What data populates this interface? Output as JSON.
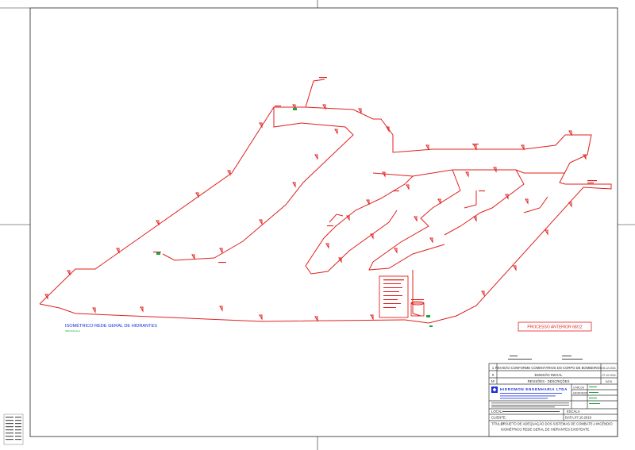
{
  "drawing": {
    "caption": "ISOMÉTRICO REDE GERAL DE HIDRANTES",
    "caption_sub": "SEM ESCALA",
    "process_box": "PROCESSO ANTERIOR 68/12",
    "colors": {
      "pipe": "#e0201e",
      "caption": "#1a2fd6",
      "marker": "#1aa83a",
      "process_box": "#e0201e",
      "logo": "#1a2fd6"
    }
  },
  "title_block": {
    "revisions": [
      {
        "no": "1",
        "description": "REVISÃO CONFORME COMENTÁRIOS DO CORPO DE BOMBEIROS",
        "date": "05.12.2016"
      },
      {
        "no": "0",
        "description": "EMISSÃO INICIAL",
        "date": "07.10.2016"
      }
    ],
    "rev_header": {
      "no": "Nº",
      "description": "REVISÕES - DESCRIÇÕES",
      "date": "DATA"
    },
    "company": "HIDROMON ENGENHARIA LTDA",
    "signers": [
      "CARLOS",
      "HIDROMON"
    ],
    "escala_label": "ESCALA",
    "local_label": "LOCAL:",
    "cliente_label": "CLIENTE:",
    "data_label": "DATA:",
    "date": "07.10.2016",
    "titulo_label": "TÍTULO:",
    "title_line1": "PROJETO DE ADEQUAÇÃO DOS SISTEMAS DE COMBATE A INCÊNDIO",
    "title_line2": "ISOMÉTRICO REDE GERAL DE HIDRANTES EXISTENTE"
  }
}
